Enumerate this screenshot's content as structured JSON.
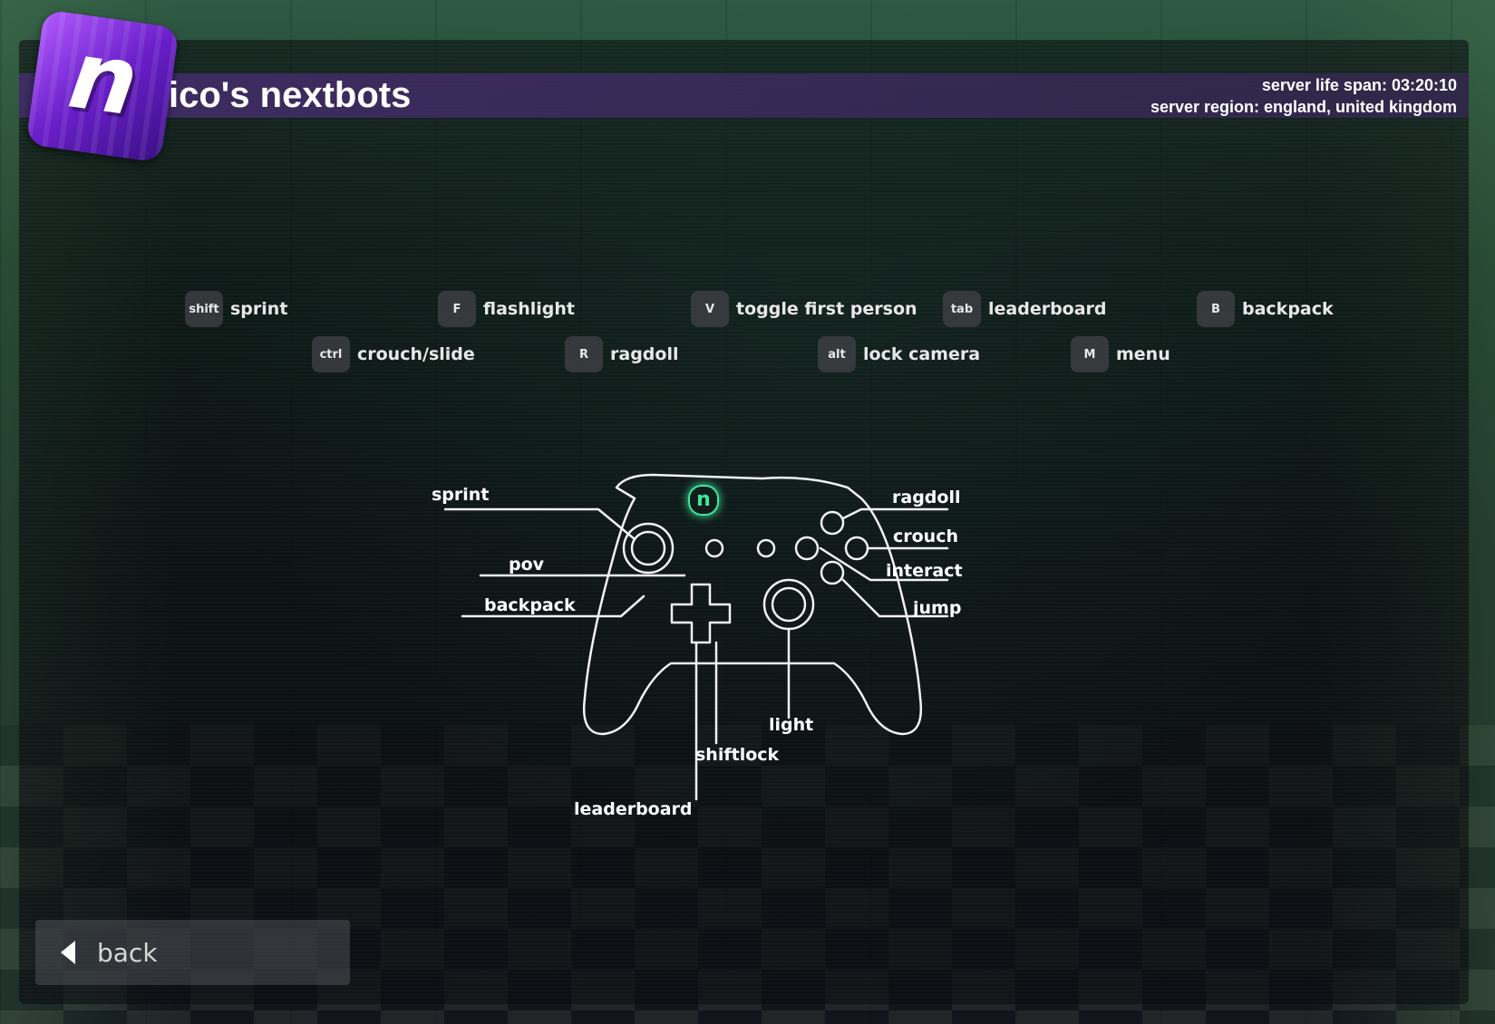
{
  "header": {
    "logo_letter": "n",
    "title": "ico's nextbots",
    "server_life_span": "server life span: 03:20:10",
    "server_region": "server region: england, united kingdom"
  },
  "keybinds": [
    {
      "key": "shift",
      "action": "sprint"
    },
    {
      "key": "F",
      "action": "flashlight"
    },
    {
      "key": "V",
      "action": "toggle first person"
    },
    {
      "key": "tab",
      "action": "leaderboard"
    },
    {
      "key": "B",
      "action": "backpack"
    },
    {
      "key": "ctrl",
      "action": "crouch/slide"
    },
    {
      "key": "R",
      "action": "ragdoll"
    },
    {
      "key": "alt",
      "action": "lock camera"
    },
    {
      "key": "M",
      "action": "menu"
    }
  ],
  "controller": {
    "logo_letter": "n",
    "labels": {
      "sprint": "sprint",
      "pov": "pov",
      "backpack": "backpack",
      "ragdoll": "ragdoll",
      "crouch": "crouch",
      "interact": "interact",
      "jump": "jump",
      "light": "light",
      "shiftlock": "shiftlock",
      "leaderboard": "leaderboard"
    }
  },
  "footer": {
    "back_label": "back"
  },
  "colors": {
    "header_bar": "#46306e",
    "logo_accent": "#7a2fe0",
    "controller_accent": "#3ee8a0"
  }
}
